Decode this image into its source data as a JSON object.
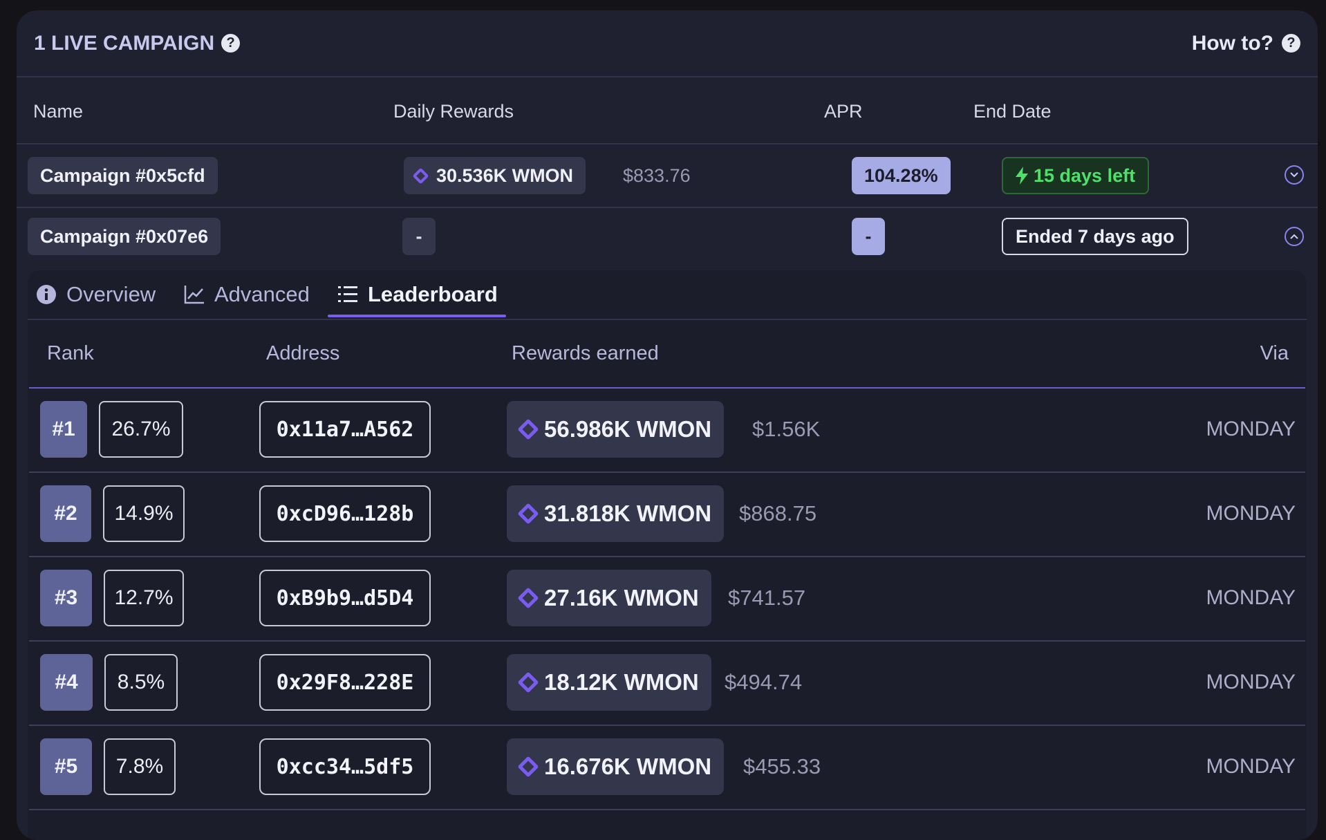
{
  "header": {
    "title": "1 LIVE CAMPAIGN",
    "howto": "How to?"
  },
  "columns": {
    "name": "Name",
    "daily": "Daily Rewards",
    "apr": "APR",
    "end": "End Date"
  },
  "campaigns": [
    {
      "name": "Campaign #0x5cfd",
      "reward": "30.536K WMON",
      "usd": "$833.76",
      "apr": "104.28%",
      "end": "15 days left"
    },
    {
      "name": "Campaign #0x07e6",
      "reward": "-",
      "apr": "-",
      "end": "Ended 7 days ago"
    }
  ],
  "tabs": {
    "overview": "Overview",
    "advanced": "Advanced",
    "leaderboard": "Leaderboard"
  },
  "leaderboard": {
    "headers": {
      "rank": "Rank",
      "address": "Address",
      "rewards": "Rewards earned",
      "via": "Via"
    },
    "rows": [
      {
        "rank": "#1",
        "pct": "26.7%",
        "address": "0x11a7…A562",
        "reward": "56.986K WMON",
        "usd": "$1.56K",
        "via": "MONDAY"
      },
      {
        "rank": "#2",
        "pct": "14.9%",
        "address": "0xcD96…128b",
        "reward": "31.818K WMON",
        "usd": "$868.75",
        "via": "MONDAY"
      },
      {
        "rank": "#3",
        "pct": "12.7%",
        "address": "0xB9b9…d5D4",
        "reward": "27.16K WMON",
        "usd": "$741.57",
        "via": "MONDAY"
      },
      {
        "rank": "#4",
        "pct": "8.5%",
        "address": "0x29F8…228E",
        "reward": "18.12K WMON",
        "usd": "$494.74",
        "via": "MONDAY"
      },
      {
        "rank": "#5",
        "pct": "7.8%",
        "address": "0xcc34…5df5",
        "reward": "16.676K WMON",
        "usd": "$455.33",
        "via": "MONDAY"
      }
    ]
  }
}
